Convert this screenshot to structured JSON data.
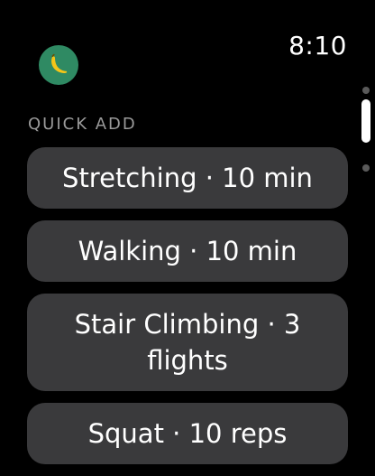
{
  "status_bar": {
    "time": "8:10"
  },
  "app_icon": {
    "icon": "banana-icon",
    "background_color": "#2f8a63",
    "icon_color": "#f5c518"
  },
  "section": {
    "title": "QUICK ADD"
  },
  "quick_add": {
    "items": [
      {
        "label": "Stretching · 10 min"
      },
      {
        "label": "Walking · 10 min"
      },
      {
        "label": "Stair Climbing · 3 flights"
      },
      {
        "label": "Squat · 10 reps"
      }
    ]
  },
  "scroll": {
    "position": 0
  }
}
